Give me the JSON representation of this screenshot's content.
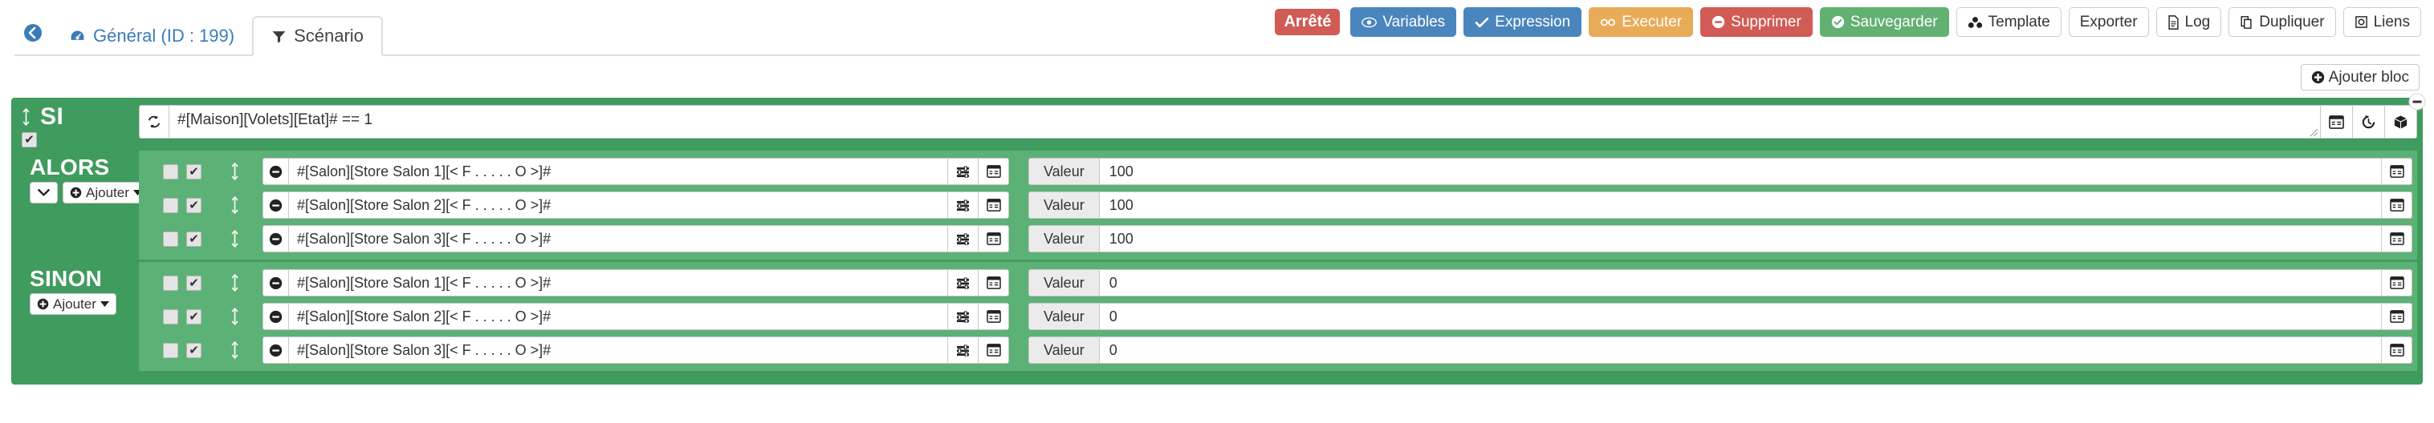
{
  "header": {
    "back_icon": "arrow-circle-left-icon",
    "tabs": [
      {
        "icon": "dashboard-icon",
        "label": "Général (ID : 199)",
        "active": false
      },
      {
        "icon": "filter-icon",
        "label": "Scénario",
        "active": true
      }
    ],
    "status_badge": "Arrêté",
    "buttons": [
      {
        "icon": "eye-icon",
        "label": "Variables",
        "style": "b-primary"
      },
      {
        "icon": "check-icon",
        "label": "Expression",
        "style": "b-primary"
      },
      {
        "icon": "cogs-icon",
        "label": "Executer",
        "style": "b-warning"
      },
      {
        "icon": "minus-circle-icon",
        "label": "Supprimer",
        "style": "b-danger"
      },
      {
        "icon": "check-circle-icon",
        "label": "Sauvegarder",
        "style": "b-success"
      },
      {
        "icon": "cubes-icon",
        "label": "Template",
        "style": "b-default"
      },
      {
        "icon": "",
        "label": "Exporter",
        "style": "b-default"
      },
      {
        "icon": "file-icon",
        "label": "Log",
        "style": "b-default"
      },
      {
        "icon": "copy-icon",
        "label": "Dupliquer",
        "style": "b-default"
      },
      {
        "icon": "link-icon",
        "label": "Liens",
        "style": "b-default"
      }
    ]
  },
  "colors": {
    "rail_green": "#3f9b5e",
    "panel_green": "#5cb176",
    "danger": "#d15b55",
    "primary": "#4a86bd",
    "warning": "#e8ab58",
    "success": "#62b072",
    "tab_link": "#3b7cb8"
  },
  "add_block": {
    "icon": "plus-circle-icon",
    "label": "Ajouter bloc"
  },
  "block": {
    "si": {
      "label": "SI",
      "enabled_checkbox": true,
      "drag_icon": "arrows-v-icon",
      "refresh_icon": "refresh-icon",
      "condition": "#[Maison][Volets][Etat]# == 1",
      "right_icons": [
        "window-icon",
        "history-icon",
        "cube-icon"
      ],
      "remove_icon": "minus-circle-icon"
    },
    "branches": [
      {
        "title": "ALORS",
        "has_collapse": true,
        "collapse_icon": "chevron-down-icon",
        "add_label": "Ajouter",
        "add_icon": "plus-circle-icon",
        "caret_icon": "caret-down-icon",
        "rows": [
          {
            "cb_left": false,
            "cb_right": true,
            "drag_icon": "arrows-v-icon",
            "remove_icon": "minus-circle-icon",
            "command": "#[Salon][Store Salon 1][< F . . . . . O >]#",
            "cmd_icons": [
              "sliders-icon",
              "window-icon"
            ],
            "value_label": "Valeur",
            "value": "100",
            "value_icon": "window-icon"
          },
          {
            "cb_left": false,
            "cb_right": true,
            "drag_icon": "arrows-v-icon",
            "remove_icon": "minus-circle-icon",
            "command": "#[Salon][Store Salon 2][< F . . . . . O >]#",
            "cmd_icons": [
              "sliders-icon",
              "window-icon"
            ],
            "value_label": "Valeur",
            "value": "100",
            "value_icon": "window-icon"
          },
          {
            "cb_left": false,
            "cb_right": true,
            "drag_icon": "arrows-v-icon",
            "remove_icon": "minus-circle-icon",
            "command": "#[Salon][Store Salon 3][< F . . . . . O >]#",
            "cmd_icons": [
              "sliders-icon",
              "window-icon"
            ],
            "value_label": "Valeur",
            "value": "100",
            "value_icon": "window-icon"
          }
        ]
      },
      {
        "title": "SINON",
        "has_collapse": false,
        "collapse_icon": "",
        "add_label": "Ajouter",
        "add_icon": "plus-circle-icon",
        "caret_icon": "caret-down-icon",
        "rows": [
          {
            "cb_left": false,
            "cb_right": true,
            "drag_icon": "arrows-v-icon",
            "remove_icon": "minus-circle-icon",
            "command": "#[Salon][Store Salon 1][< F . . . . . O >]#",
            "cmd_icons": [
              "sliders-icon",
              "window-icon"
            ],
            "value_label": "Valeur",
            "value": "0",
            "value_icon": "window-icon"
          },
          {
            "cb_left": false,
            "cb_right": true,
            "drag_icon": "arrows-v-icon",
            "remove_icon": "minus-circle-icon",
            "command": "#[Salon][Store Salon 2][< F . . . . . O >]#",
            "cmd_icons": [
              "sliders-icon",
              "window-icon"
            ],
            "value_label": "Valeur",
            "value": "0",
            "value_icon": "window-icon"
          },
          {
            "cb_left": false,
            "cb_right": true,
            "drag_icon": "arrows-v-icon",
            "remove_icon": "minus-circle-icon",
            "command": "#[Salon][Store Salon 3][< F . . . . . O >]#",
            "cmd_icons": [
              "sliders-icon",
              "window-icon"
            ],
            "value_label": "Valeur",
            "value": "0",
            "value_icon": "window-icon"
          }
        ]
      }
    ]
  }
}
